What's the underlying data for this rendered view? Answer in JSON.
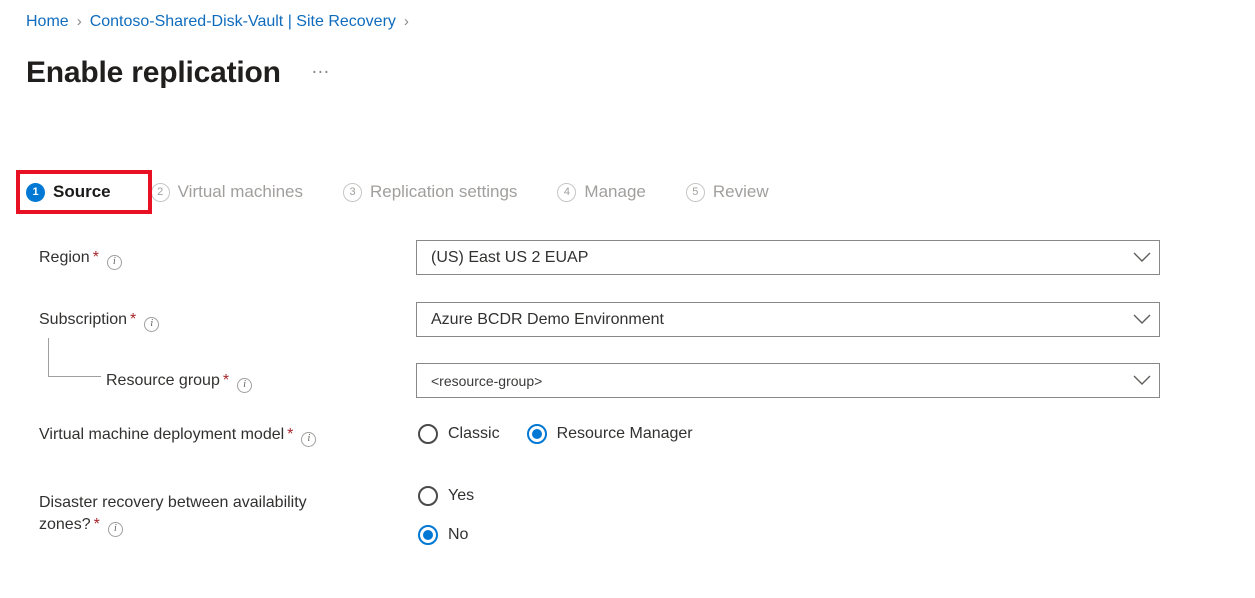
{
  "breadcrumb": {
    "separator": "›",
    "items": [
      {
        "label": "Home"
      },
      {
        "label": "Contoso-Shared-Disk-Vault | Site Recovery"
      }
    ]
  },
  "header": {
    "title": "Enable replication",
    "more_label": "…"
  },
  "wizard": {
    "active_index": 0,
    "highlight_color": "#e81123",
    "accent_color": "#0078d4",
    "steps": [
      {
        "number": "1",
        "label": "Source"
      },
      {
        "number": "2",
        "label": "Virtual machines"
      },
      {
        "number": "3",
        "label": "Replication settings"
      },
      {
        "number": "4",
        "label": "Manage"
      },
      {
        "number": "5",
        "label": "Review"
      }
    ]
  },
  "form": {
    "required_marker": "*",
    "info_glyph": "i",
    "region": {
      "label": "Region",
      "value": "(US) East US 2 EUAP"
    },
    "subscription": {
      "label": "Subscription",
      "value": "Azure BCDR Demo Environment"
    },
    "resource_group": {
      "label": "Resource group",
      "value": "<resource-group>"
    },
    "deployment_model": {
      "label": "Virtual machine deployment model",
      "options": [
        {
          "label": "Classic",
          "selected": false
        },
        {
          "label": "Resource Manager",
          "selected": true
        }
      ]
    },
    "availability_zones": {
      "label_line1": "Disaster recovery between availability",
      "label_line2": "zones?",
      "options": [
        {
          "label": "Yes",
          "selected": false
        },
        {
          "label": "No",
          "selected": true
        }
      ]
    }
  }
}
